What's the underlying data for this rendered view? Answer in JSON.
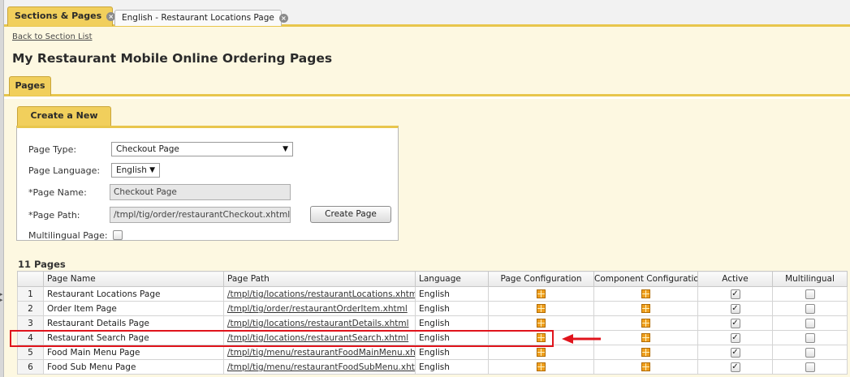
{
  "tabs": {
    "active_label": "Sections & Pages",
    "second_label": "English - Restaurant Locations Page"
  },
  "header": {
    "back_link": "Back to Section List",
    "title": "My Restaurant Mobile Online Ordering Pages"
  },
  "pages_tab_label": "Pages",
  "create_panel": {
    "tab_label": "Create a New Page",
    "page_type_label": "Page Type:",
    "page_type_value": "Checkout Page",
    "page_language_label": "Page Language:",
    "page_language_value": "English",
    "page_name_label": "*Page Name:",
    "page_name_value": "Checkout Page",
    "page_path_label": "*Page Path:",
    "page_path_value": "/tmpl/tig/order/restaurantCheckout.xhtml",
    "multilingual_label": "Multilingual Page:",
    "create_button": "Create Page"
  },
  "table": {
    "count_label": "11 Pages",
    "headers": [
      "Page Name",
      "Page Path",
      "Language",
      "Page Configuration",
      "Component Configuration",
      "Active",
      "Multilingual"
    ],
    "rows": [
      {
        "num": "1",
        "name": "Restaurant Locations Page",
        "path": "/tmpl/tig/locations/restaurantLocations.xhtml",
        "language": "English",
        "active": true,
        "multilingual": false
      },
      {
        "num": "2",
        "name": "Order Item Page",
        "path": "/tmpl/tig/order/restaurantOrderItem.xhtml",
        "language": "English",
        "active": true,
        "multilingual": false
      },
      {
        "num": "3",
        "name": "Restaurant Details Page",
        "path": "/tmpl/tig/locations/restaurantDetails.xhtml",
        "language": "English",
        "active": true,
        "multilingual": false
      },
      {
        "num": "4",
        "name": "Restaurant Search Page",
        "path": "/tmpl/tig/locations/restaurantSearch.xhtml",
        "language": "English",
        "active": true,
        "multilingual": false
      },
      {
        "num": "5",
        "name": "Food Main Menu Page",
        "path": "/tmpl/tig/menu/restaurantFoodMainMenu.xhtml",
        "language": "English",
        "active": true,
        "multilingual": false
      },
      {
        "num": "6",
        "name": "Food Sub Menu Page",
        "path": "/tmpl/tig/menu/restaurantFoodSubMenu.xhtml",
        "language": "English",
        "active": true,
        "multilingual": false
      }
    ]
  },
  "icons": {
    "config_icon": "grid-config-icon",
    "tab_close_icon": "close-circle-icon",
    "dropdown_icon": "caret-down-icon"
  },
  "colors": {
    "tab_accent": "#f1cf5c",
    "highlight": "#e0141c",
    "config_icon": "#f0a020"
  }
}
